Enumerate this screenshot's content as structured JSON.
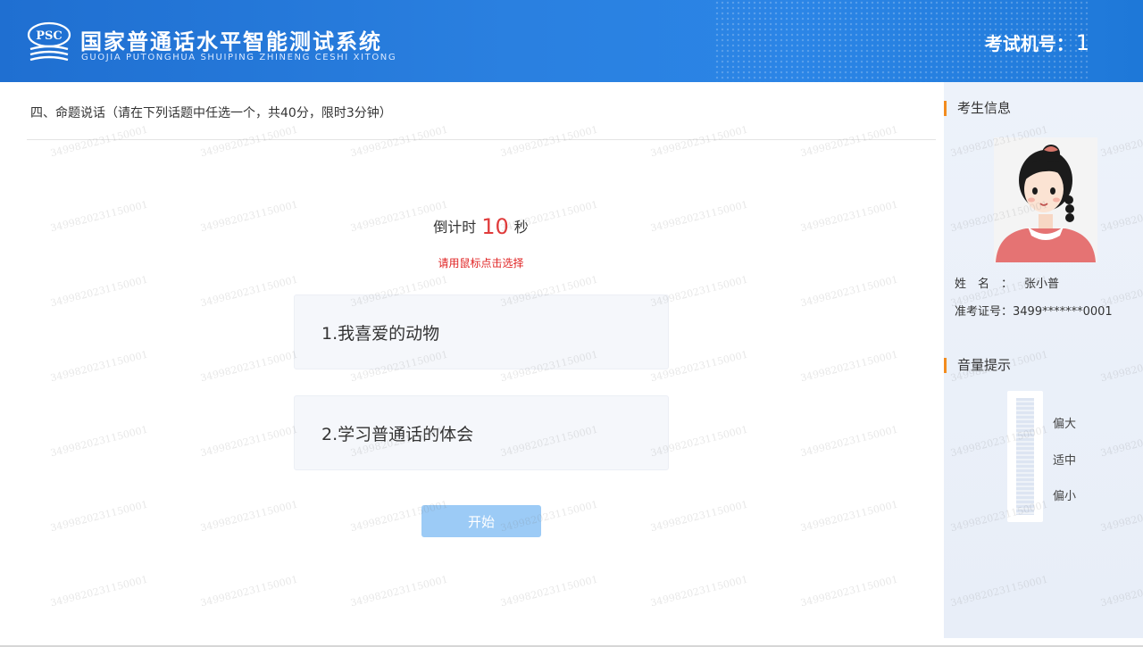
{
  "header": {
    "logo_text": "PSC",
    "title_cn": "国家普通话水平智能测试系统",
    "title_en": "GUOJIA PUTONGHUA SHUIPING ZHINENG CESHI XITONG",
    "machine_label": "考试机号：",
    "machine_number": "1"
  },
  "section": {
    "title": "四、命题说话（请在下列话题中任选一个，共40分，限时3分钟）"
  },
  "countdown": {
    "prefix": "倒计时",
    "seconds": "10",
    "suffix": "秒",
    "hint": "请用鼠标点击选择"
  },
  "topics": [
    {
      "label": "1.我喜爱的动物"
    },
    {
      "label": "2.学习普通话的体会"
    }
  ],
  "start_button": {
    "label": "开始"
  },
  "sidebar": {
    "examinee_title": "考生信息",
    "name_label": "姓名：",
    "name_value": "张小普",
    "id_label": "准考证号：",
    "id_value": "3499*******0001",
    "volume_title": "音量提示",
    "volume_levels": [
      "偏大",
      "适中",
      "偏小"
    ]
  },
  "watermark": "3499820231150001",
  "colors": {
    "header_blue": "#2a80e0",
    "accent_orange": "#f28c1f",
    "countdown_red": "#e03b3b",
    "start_button_blue": "#9ccbf6"
  }
}
